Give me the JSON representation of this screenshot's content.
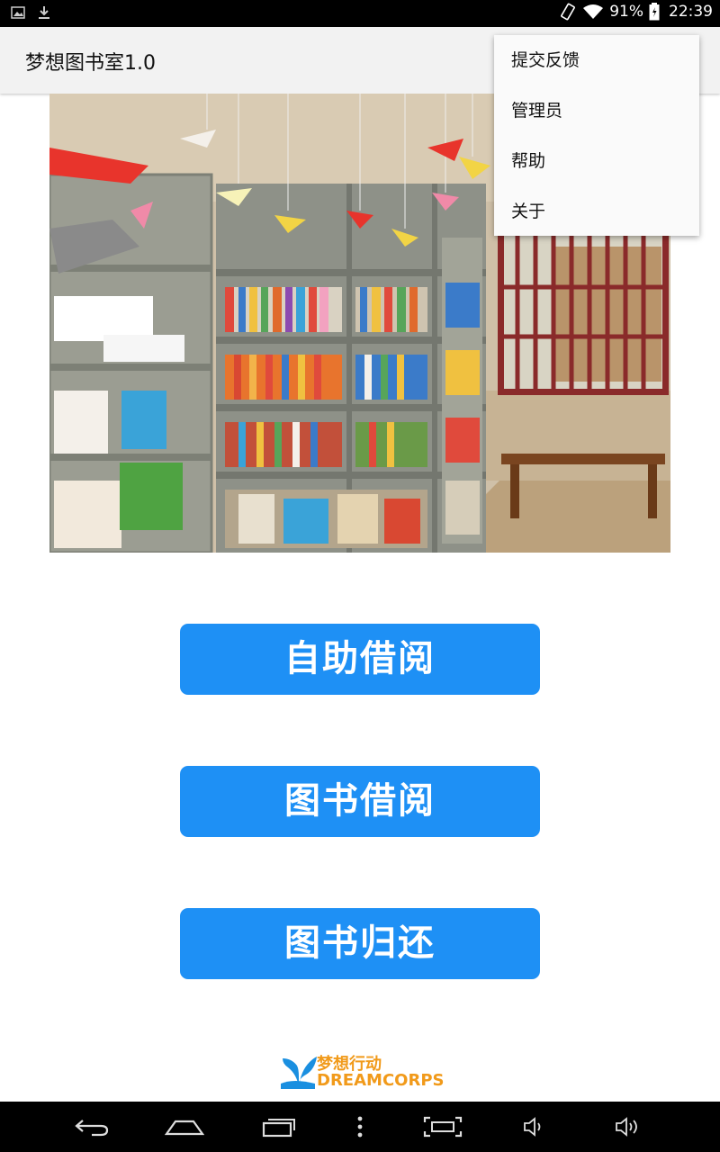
{
  "status_bar": {
    "battery": "91%",
    "time": "22:39",
    "icons": [
      "image-icon",
      "download-icon",
      "rotate-icon",
      "wifi-icon",
      "battery-icon"
    ]
  },
  "app_bar": {
    "title": "梦想图书室1.0"
  },
  "overflow_menu": {
    "items": [
      {
        "label": "提交反馈"
      },
      {
        "label": "管理员"
      },
      {
        "label": "帮助"
      },
      {
        "label": "关于"
      }
    ]
  },
  "actions": {
    "self_service": "自助借阅",
    "borrow": "图书借阅",
    "return": "图书归还"
  },
  "logo": {
    "cn": "梦想行动",
    "en": "DREAMCORPS"
  },
  "nav_bar": {
    "icons": [
      "back-icon",
      "home-icon",
      "recents-icon",
      "more-icon",
      "screenshot-icon",
      "volume-down-icon",
      "volume-up-icon"
    ]
  },
  "colors": {
    "accent": "#1e90f5",
    "logo_orange": "#f19a1a",
    "logo_blue": "#1a8fe0"
  }
}
